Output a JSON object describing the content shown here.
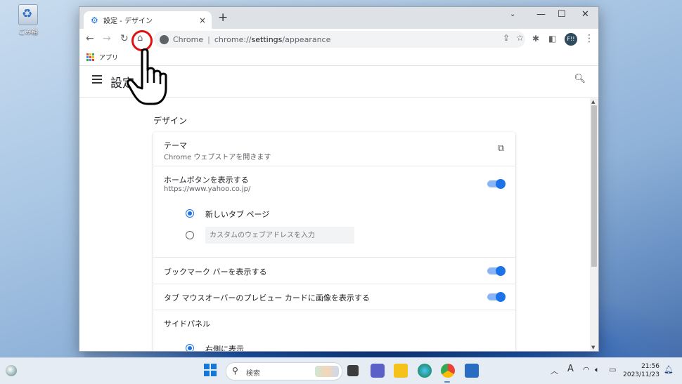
{
  "desktop": {
    "recycle_bin_label": "ごみ箱"
  },
  "browser": {
    "tab_title": "設定 - デザイン",
    "tab_close": "×",
    "new_tab": "+",
    "window_controls": {
      "dropdown": "⌄",
      "minimize": "—",
      "maximize": "☐",
      "close": "✕"
    },
    "omnibox": {
      "site": "Chrome",
      "url_prefix": "chrome://",
      "url_strong": "settings",
      "url_suffix": "/appearance"
    },
    "profile_initials": "F!!",
    "bookmarks": {
      "apps_label": "アプリ"
    }
  },
  "settings": {
    "title": "設定",
    "section_title": "デザイン",
    "theme": {
      "label": "テーマ",
      "sub": "Chrome ウェブストアを開きます"
    },
    "home_button": {
      "label": "ホームボタンを表示する",
      "sub": "https://www.yahoo.co.jp/",
      "enabled": true
    },
    "home_options": {
      "new_tab": "新しいタブ ページ",
      "custom_placeholder": "カスタムのウェブアドレスを入力",
      "selected": "new_tab"
    },
    "bookmark_bar": {
      "label": "ブックマーク バーを表示する",
      "enabled": true
    },
    "tab_hover": {
      "label": "タブ マウスオーバーのプレビュー カードに画像を表示する",
      "enabled": true
    },
    "side_panel": {
      "label": "サイドパネル",
      "option_right": "右側に表示"
    }
  },
  "taskbar": {
    "search_label": "検索",
    "time": "21:56",
    "date": "2023/11/23",
    "ime": "A"
  }
}
